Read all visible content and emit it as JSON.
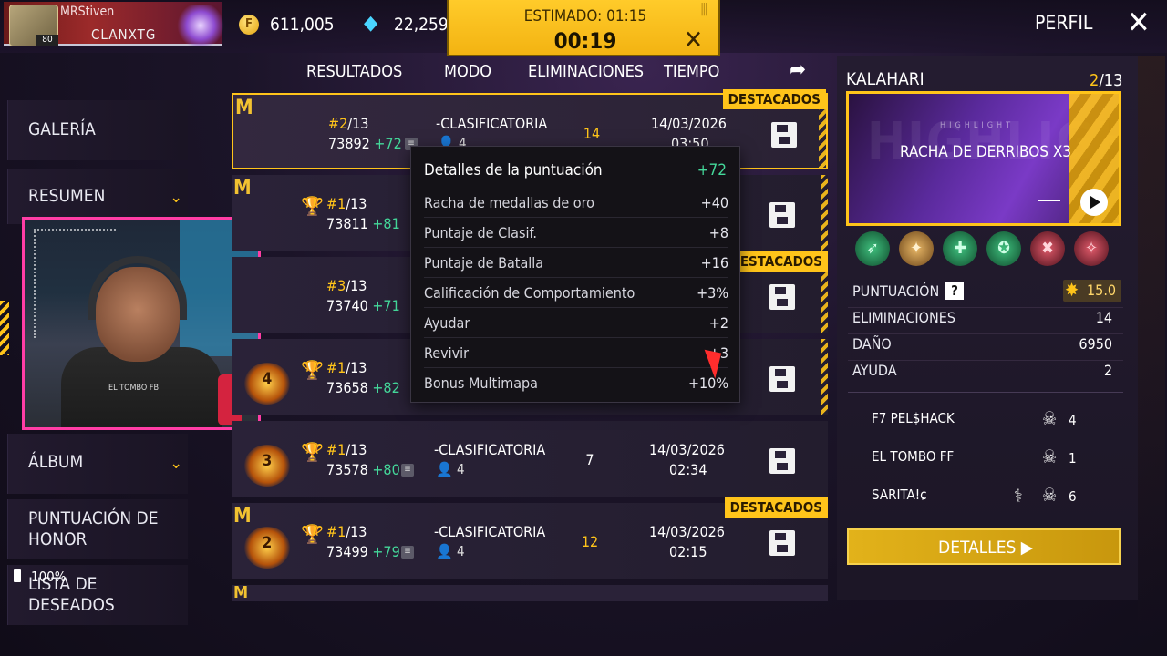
{
  "top": {
    "player_name": "MRStiven",
    "player_clan": "CLANXTG",
    "player_level": "80",
    "gold_symbol": "F",
    "gold": "611,005",
    "diamonds": "22,259",
    "estimado": "ESTIMADO: 01:15",
    "timer": "00:19",
    "perfil": "PERFIL"
  },
  "nav": [
    {
      "label": "GALERÍA"
    },
    {
      "label": "RESUMEN"
    },
    {
      "label": "ÁLBUM"
    },
    {
      "label": "PUNTUACIÓN DE HONOR"
    },
    {
      "label": "LISTA DE DESEADOS"
    }
  ],
  "battery": "100%",
  "table": {
    "headers": [
      "RESULTADOS",
      "MODO",
      "ELIMINACIONES",
      "TIEMPO"
    ],
    "destacados": "DESTACADOS",
    "rows": [
      {
        "rank": "#2",
        "of": "/13",
        "score": "73892",
        "delta": "+72",
        "mode": "-CLASIFICATORIA",
        "players": "4",
        "kills": "14",
        "date": "14/03/2026",
        "time": "03:50",
        "booyah": ""
      },
      {
        "rank": "#1",
        "of": "/13",
        "score": "73811",
        "delta": "+81",
        "mode": "",
        "players": "",
        "kills": "",
        "date": "",
        "time": "",
        "booyah": ""
      },
      {
        "rank": "#3",
        "of": "/13",
        "score": "73740",
        "delta": "+71",
        "mode": "",
        "players": "",
        "kills": "",
        "date": "",
        "time": "",
        "booyah": ""
      },
      {
        "rank": "#1",
        "of": "/13",
        "score": "73658",
        "delta": "+82",
        "mode": "",
        "players": "",
        "kills": "",
        "date": "",
        "time": "",
        "booyah": "4"
      },
      {
        "rank": "#1",
        "of": "/13",
        "score": "73578",
        "delta": "+80",
        "mode": "-CLASIFICATORIA",
        "players": "4",
        "kills": "7",
        "date": "14/03/2026",
        "time": "02:34",
        "booyah": "3"
      },
      {
        "rank": "#1",
        "of": "/13",
        "score": "73499",
        "delta": "+79",
        "mode": "-CLASIFICATORIA",
        "players": "4",
        "kills": "12",
        "date": "14/03/2026",
        "time": "02:15",
        "booyah": "2"
      }
    ]
  },
  "tooltip": {
    "title": "Detalles de la puntuación",
    "total": "+72",
    "items": [
      {
        "label": "Racha de medallas de oro",
        "value": "+40"
      },
      {
        "label": "Puntaje de Clasif.",
        "value": "+8"
      },
      {
        "label": "Puntaje de Batalla",
        "value": "+16"
      },
      {
        "label": "Calificación de Comportamiento",
        "value": "+3%"
      },
      {
        "label": "Ayudar",
        "value": "+2"
      },
      {
        "label": "Revivir",
        "value": "+3"
      },
      {
        "label": "Bonus Multimapa",
        "value": "+10%"
      }
    ]
  },
  "right": {
    "map": "KALAHARI",
    "index_current": "2",
    "index_total": "/13",
    "highlight_small": "HIGHLIGHT",
    "highlight_title": "RACHA DE DERRIBOS X3",
    "stats": [
      {
        "label": "PUNTUACIÓN",
        "value": "15.0"
      },
      {
        "label": "ELIMINACIONES",
        "value": "14"
      },
      {
        "label": "DAÑO",
        "value": "6950"
      },
      {
        "label": "AYUDA",
        "value": "2"
      }
    ],
    "team": [
      {
        "name": "F7   PEL$HACK",
        "kills": "4"
      },
      {
        "name": "EL   TOMBO   FF",
        "kills": "1"
      },
      {
        "name": "SARITA!ɕ",
        "kills": "6"
      }
    ],
    "detalles": "DETALLES"
  },
  "webcam": {
    "shirt_text": "EL TOMBO FB"
  },
  "colors": {
    "accent": "#ffc41a",
    "positive": "#44d89a",
    "stream_border": "#ff3da5"
  }
}
